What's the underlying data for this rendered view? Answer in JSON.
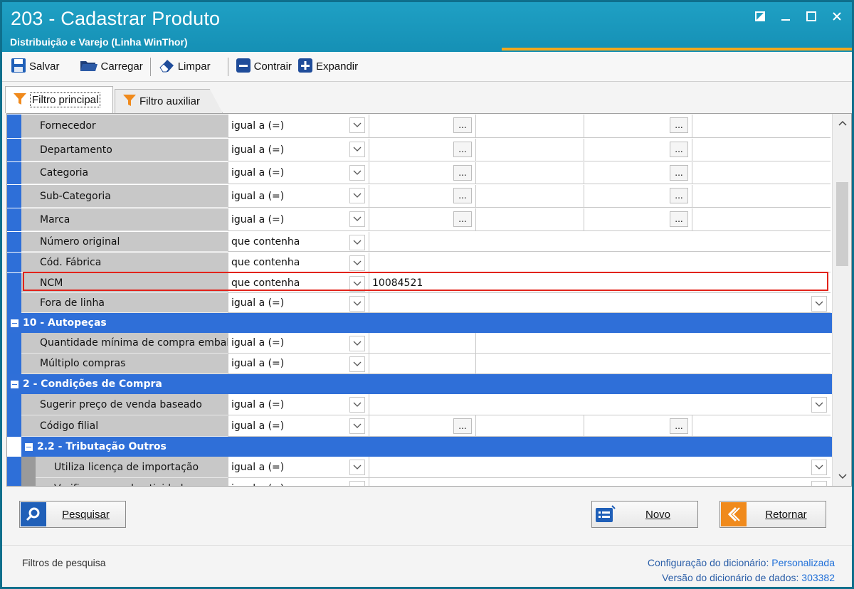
{
  "window": {
    "title": "203 - Cadastrar  Produto",
    "subtitle": "Distribuição e Varejo (Linha WinThor)",
    "colors": {
      "title_bg": "#1593b8",
      "accent": "#f2a81d",
      "group_bg": "#2f6fd8",
      "highlight": "#e2231a"
    }
  },
  "toolbar": {
    "salvar": "Salvar",
    "carregar": "Carregar",
    "limpar": "Limpar",
    "contrair": "Contrair",
    "expandir": "Expandir"
  },
  "tabs": {
    "principal": "Filtro principal",
    "auxiliar": "Filtro auxiliar"
  },
  "rows": [
    {
      "label": "Fornecedor",
      "op": "igual a (=)"
    },
    {
      "label": "Departamento",
      "op": "igual a (=)"
    },
    {
      "label": "Categoria",
      "op": "igual a (=)"
    },
    {
      "label": "Sub-Categoria",
      "op": "igual a (=)"
    },
    {
      "label": "Marca",
      "op": "igual a (=)"
    },
    {
      "label": "Número original",
      "op": "que contenha"
    },
    {
      "label": "Cód. Fábrica",
      "op": "que contenha"
    },
    {
      "label": "NCM",
      "op": "que contenha",
      "value": "10084521"
    },
    {
      "label": "Fora de linha",
      "op": "igual a (=)"
    }
  ],
  "group_autopecas": {
    "title": "10 - Autopeças",
    "rows": [
      {
        "label": "Quantidade mínima de compra embal",
        "op": "igual a (=)"
      },
      {
        "label": "Múltiplo compras",
        "op": "igual a (=)"
      }
    ]
  },
  "group_compra": {
    "title": "2 - Condições de Compra",
    "rows": [
      {
        "label": "Sugerir preço de venda baseado",
        "op": "igual a (=)"
      },
      {
        "label": "Código filial",
        "op": "igual a (=)"
      }
    ]
  },
  "group_tributacao": {
    "title": "2.2 - Tributação Outros",
    "rows": [
      {
        "label": "Utiliza licença de importação",
        "op": "igual a (=)"
      },
      {
        "label": "Verificar ramo de atividade para c",
        "op": "igual a (=)"
      }
    ]
  },
  "dots": "...",
  "buttons": {
    "pesquisar": "Pesquisar",
    "novo": "Novo",
    "retornar": "Retornar"
  },
  "status": {
    "left": "Filtros de pesquisa",
    "config_label": "Configuração do dicionário:",
    "config_value": "Personalizada",
    "version_label": "Versão do dicionário de dados:",
    "version_value": "303382"
  }
}
